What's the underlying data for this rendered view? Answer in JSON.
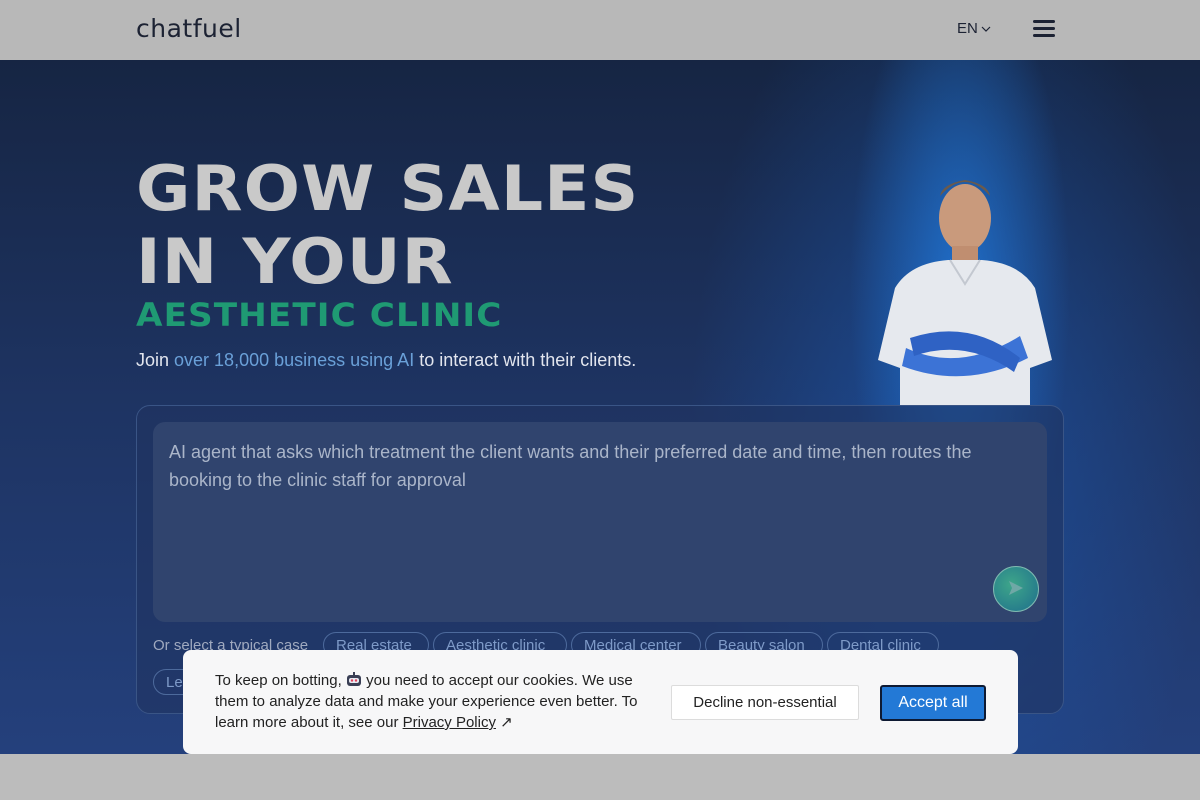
{
  "header": {
    "logo": "chatfuel",
    "language": "EN"
  },
  "hero": {
    "headline_line1": "GROW SALES",
    "headline_line2": "IN YOUR",
    "subhead": "AESTHETIC CLINIC",
    "tagline_prefix": "Join ",
    "tagline_highlight": "over 18,000 business using AI",
    "tagline_suffix": " to interact with their clients."
  },
  "composer": {
    "prompt": "AI agent that asks which treatment the client wants and their preferred date and time, then routes the booking to the clinic staff for approval",
    "cases_label": "Or select a typical case",
    "chips": [
      "Real estate",
      "Aesthetic clinic",
      "Medical center",
      "Beauty salon",
      "Dental clinic",
      "Le"
    ]
  },
  "cookie": {
    "text_prefix": "To keep on botting, ",
    "text_suffix": " you need to accept our cookies. We use them to analyze data and make your experience even better. To learn more about it, see our ",
    "link": "Privacy Policy",
    "link_icon": "↗",
    "decline": "Decline non-essential",
    "accept": "Accept all"
  },
  "colors": {
    "accent_green": "#1f9a73",
    "highlight_blue": "#6aa0d8",
    "accept_button": "#2379d6"
  }
}
